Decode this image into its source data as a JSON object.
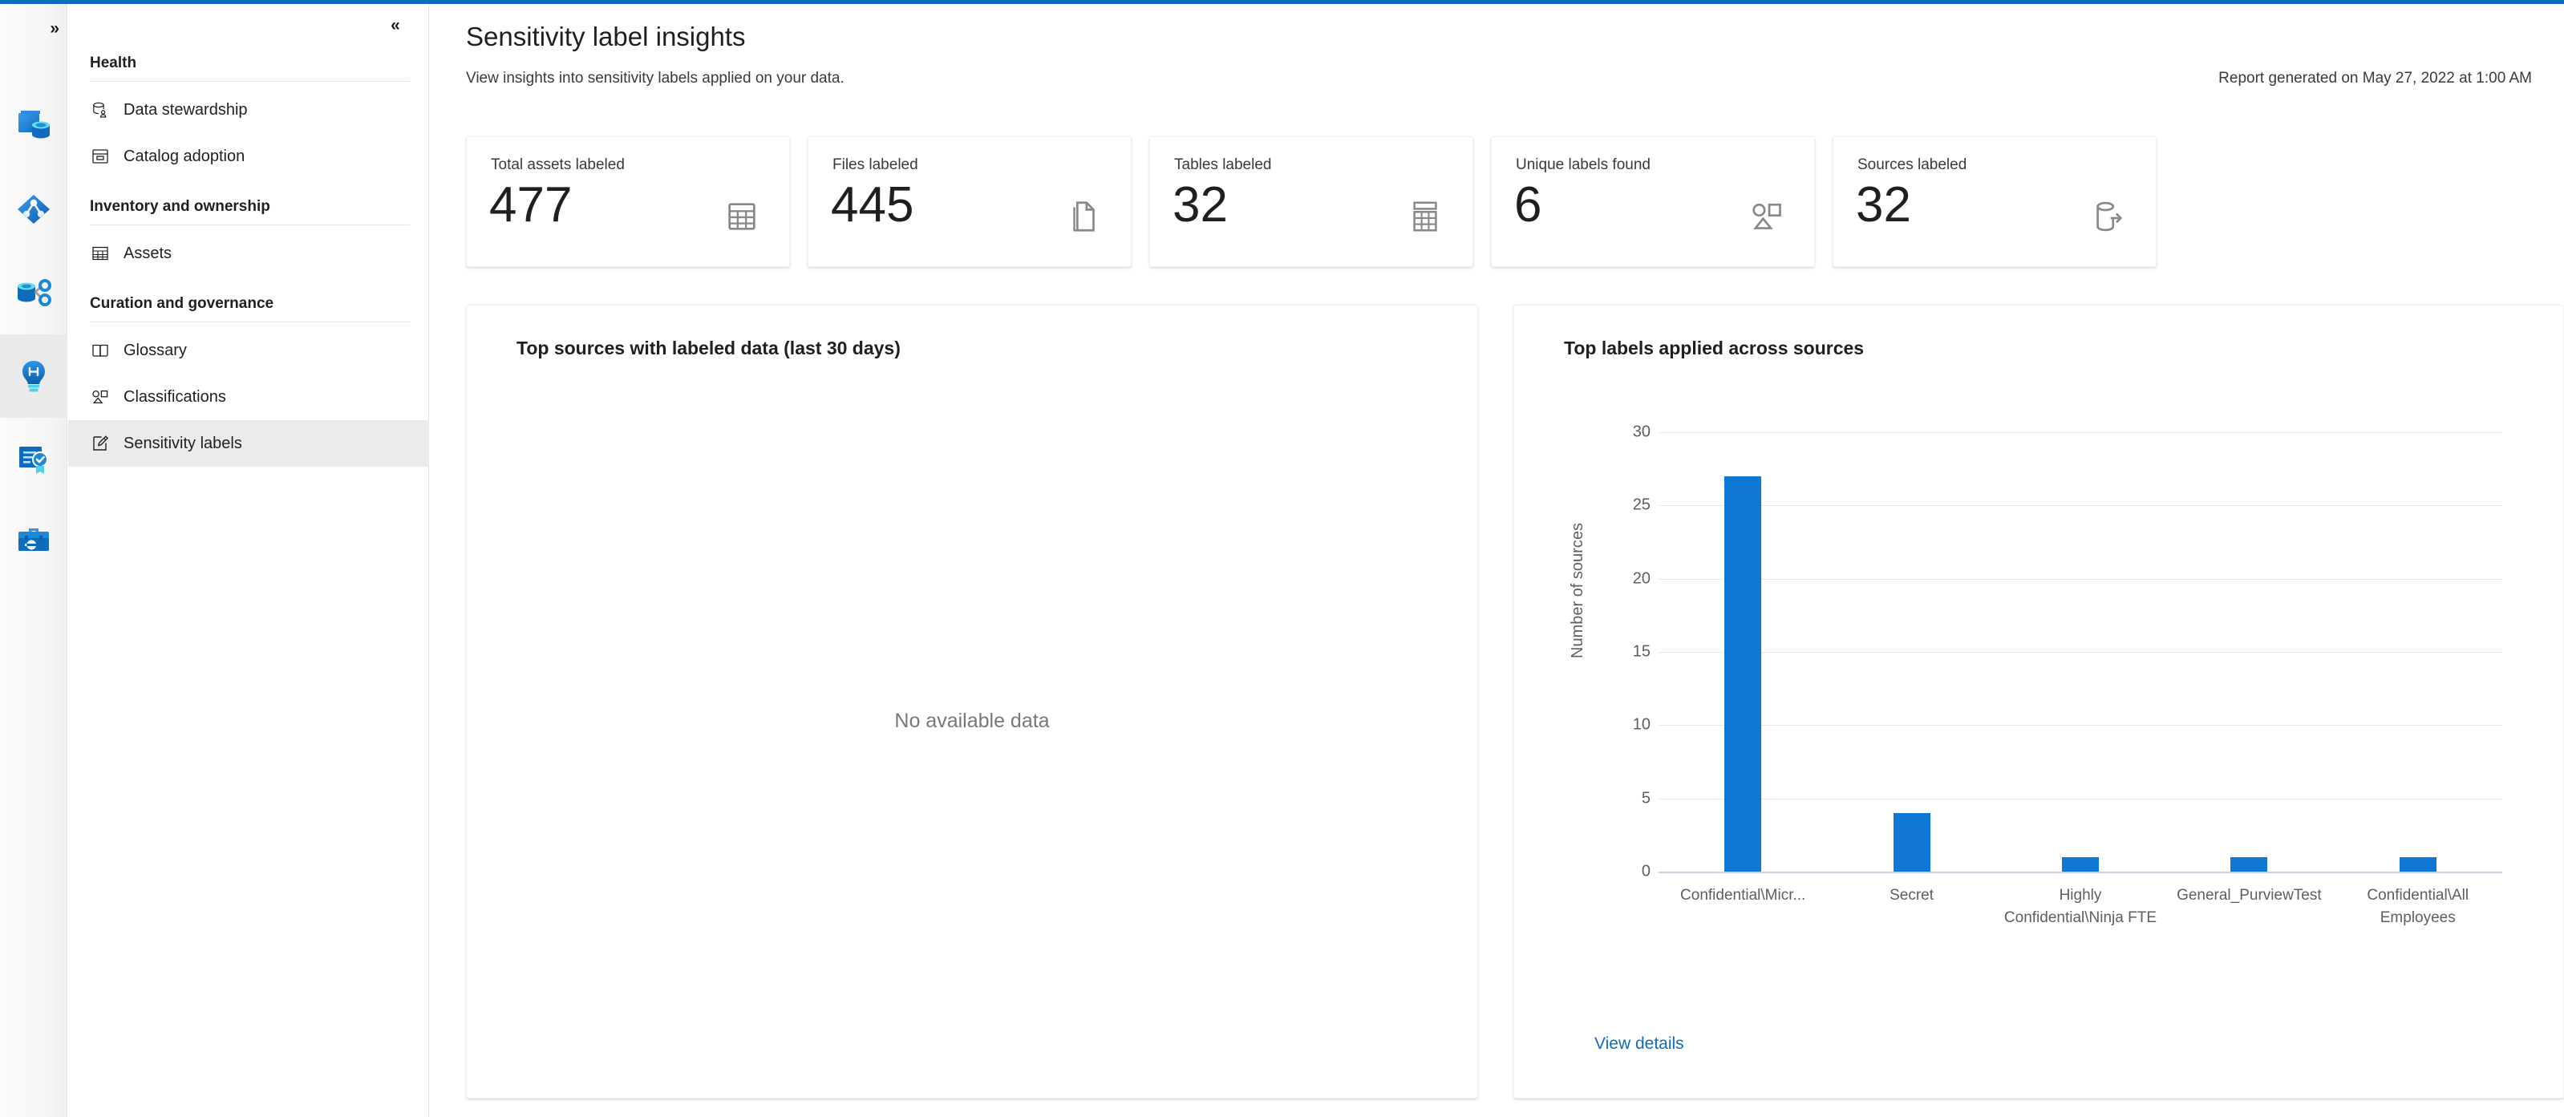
{
  "theme": {
    "accent": "#0f6cbd",
    "bar_color": "#0f78d4",
    "link_color": "#0f6cbd",
    "text_primary": "#201f1e",
    "text_secondary": "#605e5c"
  },
  "rail": {
    "expand_label": "»",
    "items": [
      {
        "name": "data-catalog",
        "icon": "catalog-icon",
        "active": false
      },
      {
        "name": "data-map",
        "icon": "data-map-icon",
        "active": false
      },
      {
        "name": "data-estate",
        "icon": "data-estate-icon",
        "active": false
      },
      {
        "name": "data-insights",
        "icon": "lightbulb-icon",
        "active": true
      },
      {
        "name": "data-policy",
        "icon": "certificate-icon",
        "active": false
      },
      {
        "name": "management",
        "icon": "toolbox-icon",
        "active": false
      }
    ]
  },
  "nav": {
    "collapse_label": "«",
    "sections": [
      {
        "title": "Health",
        "items": [
          {
            "label": "Data stewardship",
            "icon": "data-steward-icon",
            "selected": false
          },
          {
            "label": "Catalog adoption",
            "icon": "catalog-adoption-icon",
            "selected": false
          }
        ]
      },
      {
        "title": "Inventory and ownership",
        "items": [
          {
            "label": "Assets",
            "icon": "table-icon",
            "selected": false
          }
        ]
      },
      {
        "title": "Curation and governance",
        "items": [
          {
            "label": "Glossary",
            "icon": "book-icon",
            "selected": false
          },
          {
            "label": "Classifications",
            "icon": "classification-icon",
            "selected": false
          },
          {
            "label": "Sensitivity labels",
            "icon": "sensitivity-label-icon",
            "selected": true
          }
        ]
      }
    ]
  },
  "header": {
    "title": "Sensitivity label insights",
    "subtitle": "View insights into sensitivity labels applied on your data.",
    "report_generated": "Report generated on May 27, 2022 at 1:00 AM"
  },
  "kpis": [
    {
      "label": "Total assets labeled",
      "value": "477",
      "icon": "table-grid-icon"
    },
    {
      "label": "Files labeled",
      "value": "445",
      "icon": "file-icon"
    },
    {
      "label": "Tables labeled",
      "value": "32",
      "icon": "table-rows-icon"
    },
    {
      "label": "Unique labels found",
      "value": "6",
      "icon": "classification-icon"
    },
    {
      "label": "Sources labeled",
      "value": "32",
      "icon": "source-export-icon"
    }
  ],
  "panels": {
    "left": {
      "title": "Top sources with labeled data (last 30 days)",
      "empty_message": "No available data"
    },
    "right": {
      "title": "Top labels applied across sources",
      "view_details_label": "View details"
    }
  },
  "chart_data": {
    "type": "bar",
    "title": "Top labels applied across sources",
    "xlabel": "",
    "ylabel": "Number of sources",
    "categories": [
      "Confidential\\Micr...",
      "Secret",
      "Highly Confidential\\Ninja FTE",
      "General_PurviewTest",
      "Confidential\\All Employees"
    ],
    "values": [
      27,
      4,
      1,
      1,
      1
    ],
    "ylim": [
      0,
      30
    ],
    "yticks": [
      0,
      5,
      10,
      15,
      20,
      25,
      30
    ],
    "grid": true,
    "legend": false,
    "series": [
      {
        "name": "Number of sources",
        "values": [
          27,
          4,
          1,
          1,
          1
        ]
      }
    ]
  }
}
